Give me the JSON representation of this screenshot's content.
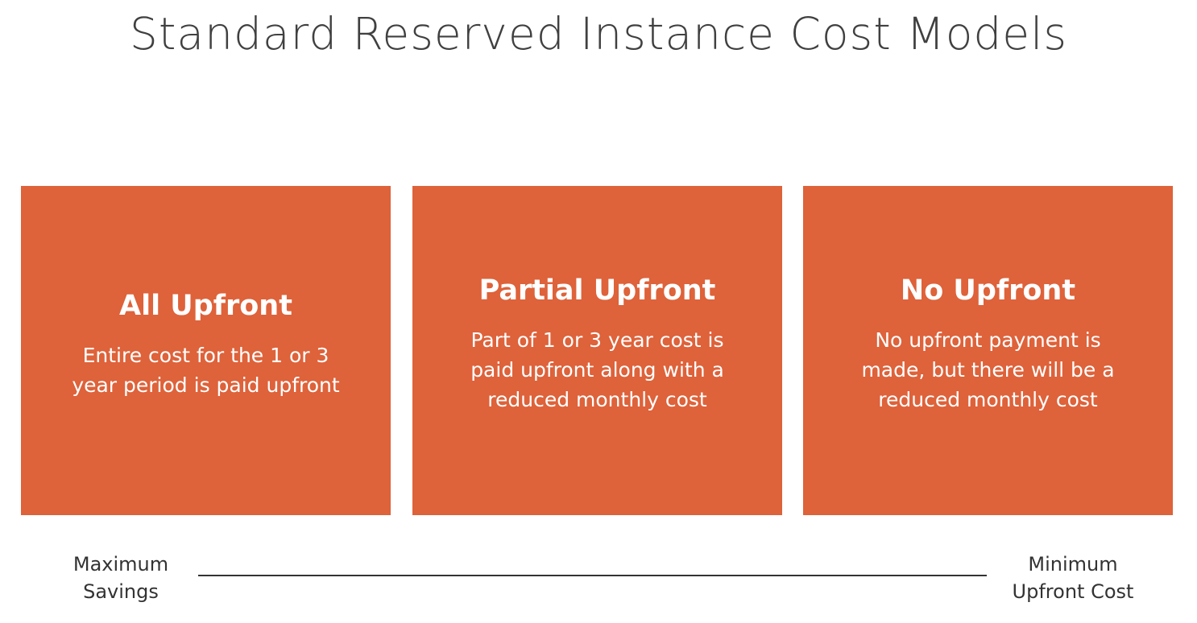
{
  "title": "Standard Reserved Instance Cost Models",
  "accent_color": "#de623a",
  "cards": [
    {
      "title": "All Upfront",
      "description_lines": [
        "Entire cost for the 1 or 3",
        "year period is paid upfront"
      ]
    },
    {
      "title": "Partial Upfront",
      "description_lines": [
        "Part of 1 or 3 year cost is",
        "paid upfront along with a",
        "reduced monthly cost"
      ]
    },
    {
      "title": "No Upfront",
      "description_lines": [
        "No upfront payment is",
        "made, but there will be a",
        "reduced monthly cost"
      ]
    }
  ],
  "scale": {
    "left_label_lines": [
      "Maximum",
      "Savings"
    ],
    "right_label_lines": [
      "Minimum",
      "Upfront Cost"
    ]
  }
}
